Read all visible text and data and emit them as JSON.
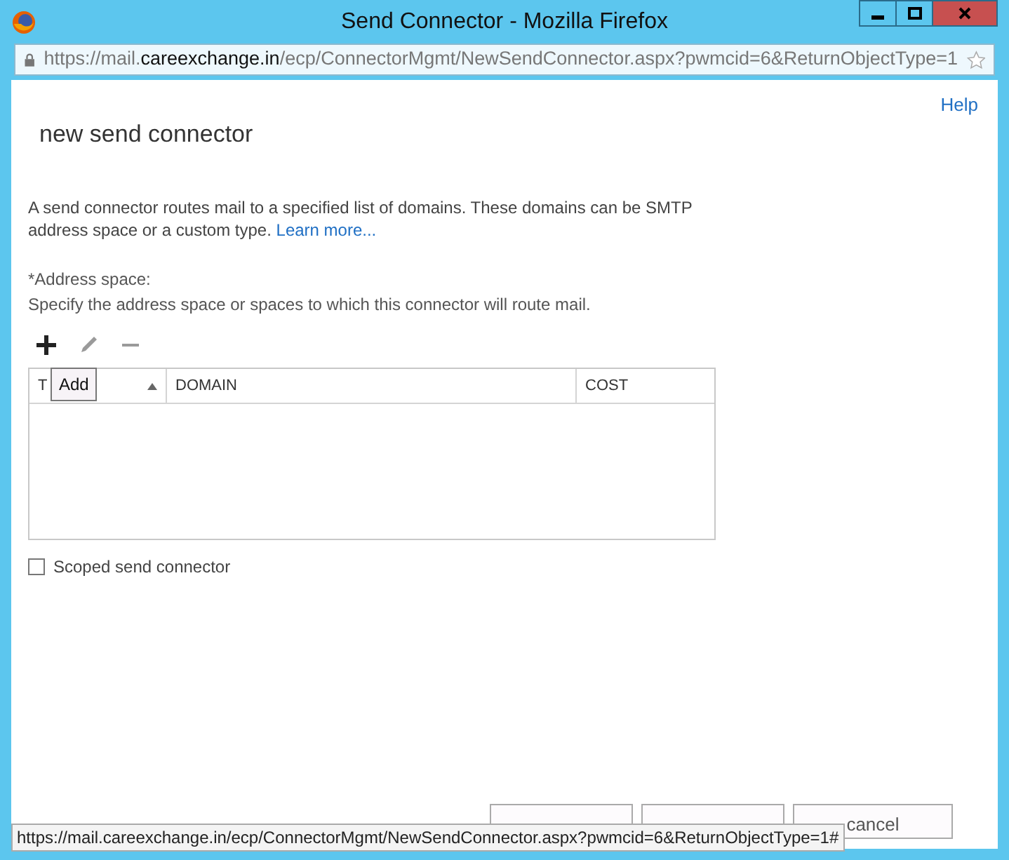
{
  "window": {
    "title": "Send Connector - Mozilla Firefox"
  },
  "address_bar": {
    "scheme": "https://mail.",
    "host": "careexchange.in",
    "path": "/ecp/ConnectorMgmt/NewSendConnector.aspx?pwmcid=6&ReturnObjectType=1"
  },
  "help_link": "Help",
  "page_title": "new send connector",
  "description": "A send connector routes mail to a specified list of domains. These domains can be SMTP address space or a custom type.",
  "learn_more": "Learn more...",
  "address_space": {
    "label": "*Address space:",
    "hint": "Specify the address space or spaces to which this connector will route mail."
  },
  "toolbar": [
    {
      "kind": "add",
      "disabled": false
    },
    {
      "kind": "edit",
      "disabled": true
    },
    {
      "kind": "remove",
      "disabled": true
    }
  ],
  "tooltip": "Add",
  "table": {
    "columns": [
      {
        "label": "T",
        "sorted": true
      },
      {
        "label": "DOMAIN",
        "sorted": false
      },
      {
        "label": "COST",
        "sorted": false
      }
    ]
  },
  "scoped": {
    "label": "Scoped send connector",
    "checked": false
  },
  "buttons": [
    {
      "kind": "blank"
    },
    {
      "kind": "blank"
    },
    {
      "kind": "labeled",
      "label": "cancel"
    }
  ],
  "status_bar": "https://mail.careexchange.in/ecp/ConnectorMgmt/NewSendConnector.aspx?pwmcid=6&ReturnObjectType=1#"
}
